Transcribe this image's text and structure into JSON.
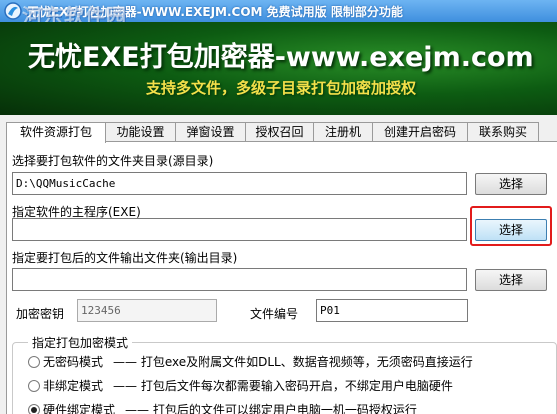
{
  "window": {
    "title": "无忧EXE打包加密器-WWW.EXEJM.COM  免费试用版  限制部分功能",
    "watermark": "河东软件园"
  },
  "banner": {
    "headline": "无忧EXE打包加密器-www.exejm.com",
    "tagline": "支持多文件，多级子目录打包加密加授权"
  },
  "tabs": [
    {
      "label": "软件资源打包",
      "active": true
    },
    {
      "label": "功能设置"
    },
    {
      "label": "弹窗设置"
    },
    {
      "label": "授权召回"
    },
    {
      "label": "注册机"
    },
    {
      "label": "创建开启密码"
    },
    {
      "label": "联系购买"
    }
  ],
  "form": {
    "source_dir_label": "选择要打包软件的文件夹目录(源目录)",
    "source_dir_value": "D:\\QQMusicCache",
    "main_exe_label": "指定软件的主程序(EXE)",
    "main_exe_value": "",
    "output_dir_label": "指定要打包后的文件输出文件夹(输出目录)",
    "output_dir_value": "",
    "browse_label": "选择",
    "key_label": "加密密钥",
    "key_value": "123456",
    "file_no_label": "文件编号",
    "file_no_value": "P01"
  },
  "mode_group": {
    "title": "指定打包加密模式",
    "options": [
      {
        "name": "无密码模式",
        "desc": "—— 打包exe及附属文件如DLL、数据音视频等，无须密码直接运行",
        "checked": false
      },
      {
        "name": "非绑定模式",
        "desc": "—— 打包后文件每次都需要输入密码开启，不绑定用户电脑硬件",
        "checked": false
      },
      {
        "name": "硬件绑定模式",
        "desc": "—— 打包后的文件可以绑定用户电脑一机一码授权运行",
        "checked": true
      }
    ]
  },
  "colors": {
    "title_bar": "#3f8fde",
    "banner_bg": "#0d5c12",
    "tagline": "#f4e04a",
    "highlight": "#e21b1b"
  }
}
